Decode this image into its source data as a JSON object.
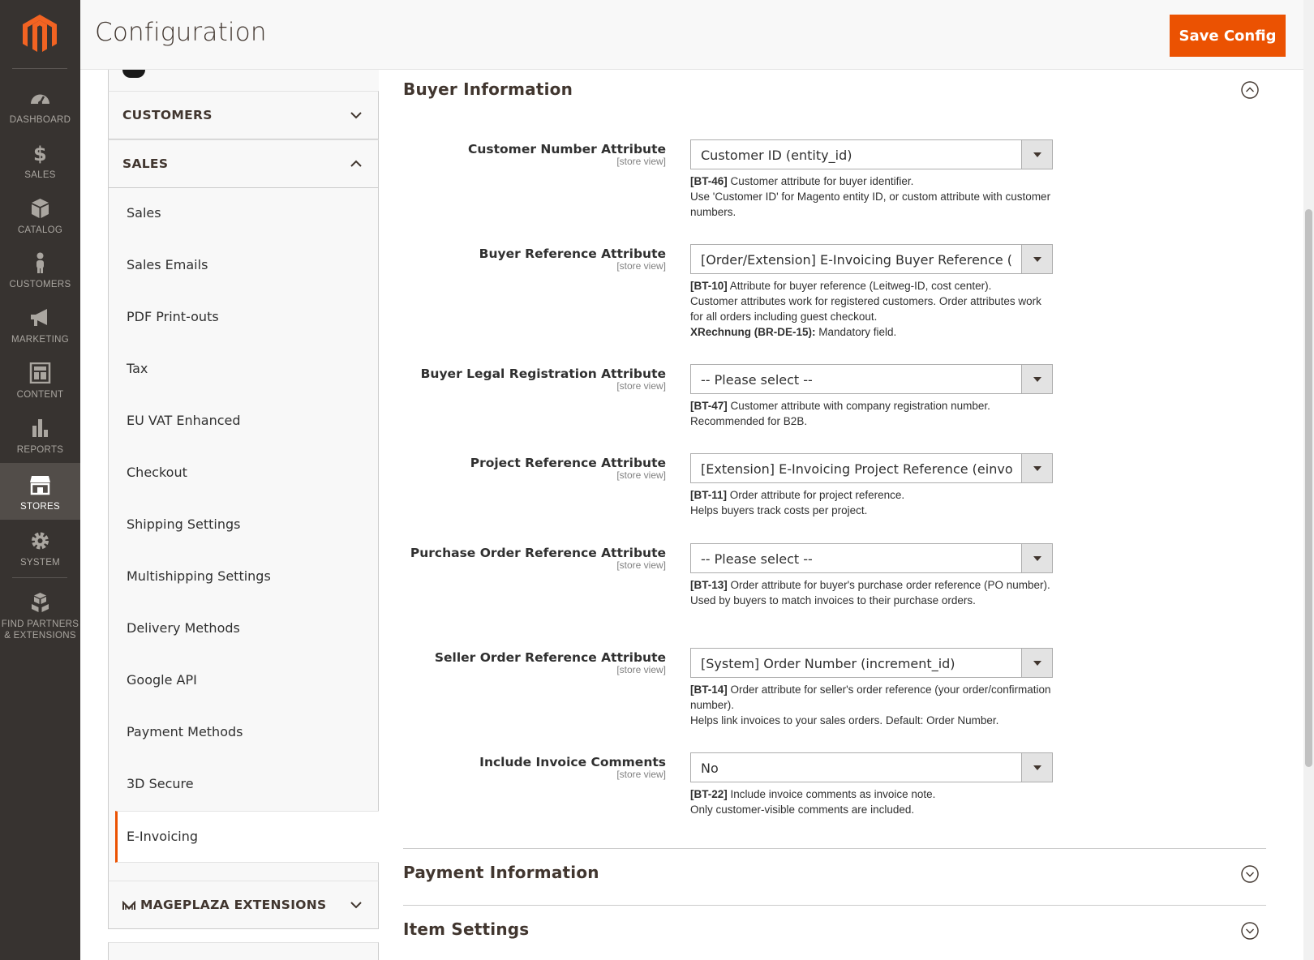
{
  "nav": {
    "items": [
      {
        "label": "DASHBOARD",
        "icon": "dashboard-icon"
      },
      {
        "label": "SALES",
        "icon": "dollar-icon"
      },
      {
        "label": "CATALOG",
        "icon": "box-icon"
      },
      {
        "label": "CUSTOMERS",
        "icon": "person-icon"
      },
      {
        "label": "MARKETING",
        "icon": "megaphone-icon"
      },
      {
        "label": "CONTENT",
        "icon": "layout-icon"
      },
      {
        "label": "REPORTS",
        "icon": "bar-chart-icon"
      },
      {
        "label": "STORES",
        "icon": "store-icon"
      },
      {
        "label": "SYSTEM",
        "icon": "gear-icon"
      },
      {
        "label_line1": "FIND PARTNERS",
        "label_line2": "& EXTENSIONS",
        "icon": "boxes-icon"
      }
    ]
  },
  "header": {
    "title": "Configuration",
    "save_label": "Save Config"
  },
  "tabs": {
    "customers": "CUSTOMERS",
    "sales": "SALES",
    "sales_items": [
      "Sales",
      "Sales Emails",
      "PDF Print-outs",
      "Tax",
      "EU VAT Enhanced",
      "Checkout",
      "Shipping Settings",
      "Multishipping Settings",
      "Delivery Methods",
      "Google API",
      "Payment Methods",
      "3D Secure",
      "E-Invoicing"
    ],
    "mageplaza": "MAGEPLAZA EXTENSIONS"
  },
  "section": {
    "buyer_title": "Buyer Information",
    "payment_title": "Payment Information",
    "item_title": "Item Settings",
    "scope": "[store view]",
    "fields": [
      {
        "label": "Customer Number Attribute",
        "value": "Customer ID (entity_id)",
        "note_code": "[BT-46]",
        "note_l1": " Customer attribute for buyer identifier.",
        "note_l2": "Use 'Customer ID' for Magento entity ID, or custom attribute with customer numbers."
      },
      {
        "label": "Buyer Reference Attribute",
        "value": "[Order/Extension] E-Invoicing Buyer Reference (einvoicing_buyer_reference)",
        "note_code": "[BT-10]",
        "note_l1": " Attribute for buyer reference (Leitweg-ID, cost center).",
        "note_l2": "Customer attributes work for registered customers. Order attributes work for all orders including guest checkout.",
        "note_bold2": "XRechnung (BR-DE-15):",
        "note_l3": " Mandatory field."
      },
      {
        "label": "Buyer Legal Registration Attribute",
        "value": "-- Please select --",
        "note_code": "[BT-47]",
        "note_l1": " Customer attribute with company registration number.",
        "note_l2": "Recommended for B2B."
      },
      {
        "label": "Project Reference Attribute",
        "value": "[Extension] E-Invoicing Project Reference (einvoicing_project_reference)",
        "note_code": "[BT-11]",
        "note_l1": " Order attribute for project reference.",
        "note_l2": "Helps buyers track costs per project."
      },
      {
        "label": "Purchase Order Reference Attribute",
        "value": "-- Please select --",
        "note_code": "[BT-13]",
        "note_l1": " Order attribute for buyer's purchase order reference (PO number).",
        "note_l2": "Used by buyers to match invoices to their purchase orders."
      },
      {
        "label": "Seller Order Reference Attribute",
        "value": "[System] Order Number (increment_id)",
        "note_code": "[BT-14]",
        "note_l1": " Order attribute for seller's order reference (your order/confirmation number).",
        "note_l2": "Helps link invoices to your sales orders. Default: Order Number."
      },
      {
        "label": "Include Invoice Comments",
        "value": "No",
        "note_code": "[BT-22]",
        "note_l1": " Include invoice comments as invoice note.",
        "note_l2": "Only customer-visible comments are included."
      }
    ]
  },
  "colors": {
    "accent": "#eb5202",
    "nav_bg": "#373330",
    "nav_active": "#524d49"
  }
}
